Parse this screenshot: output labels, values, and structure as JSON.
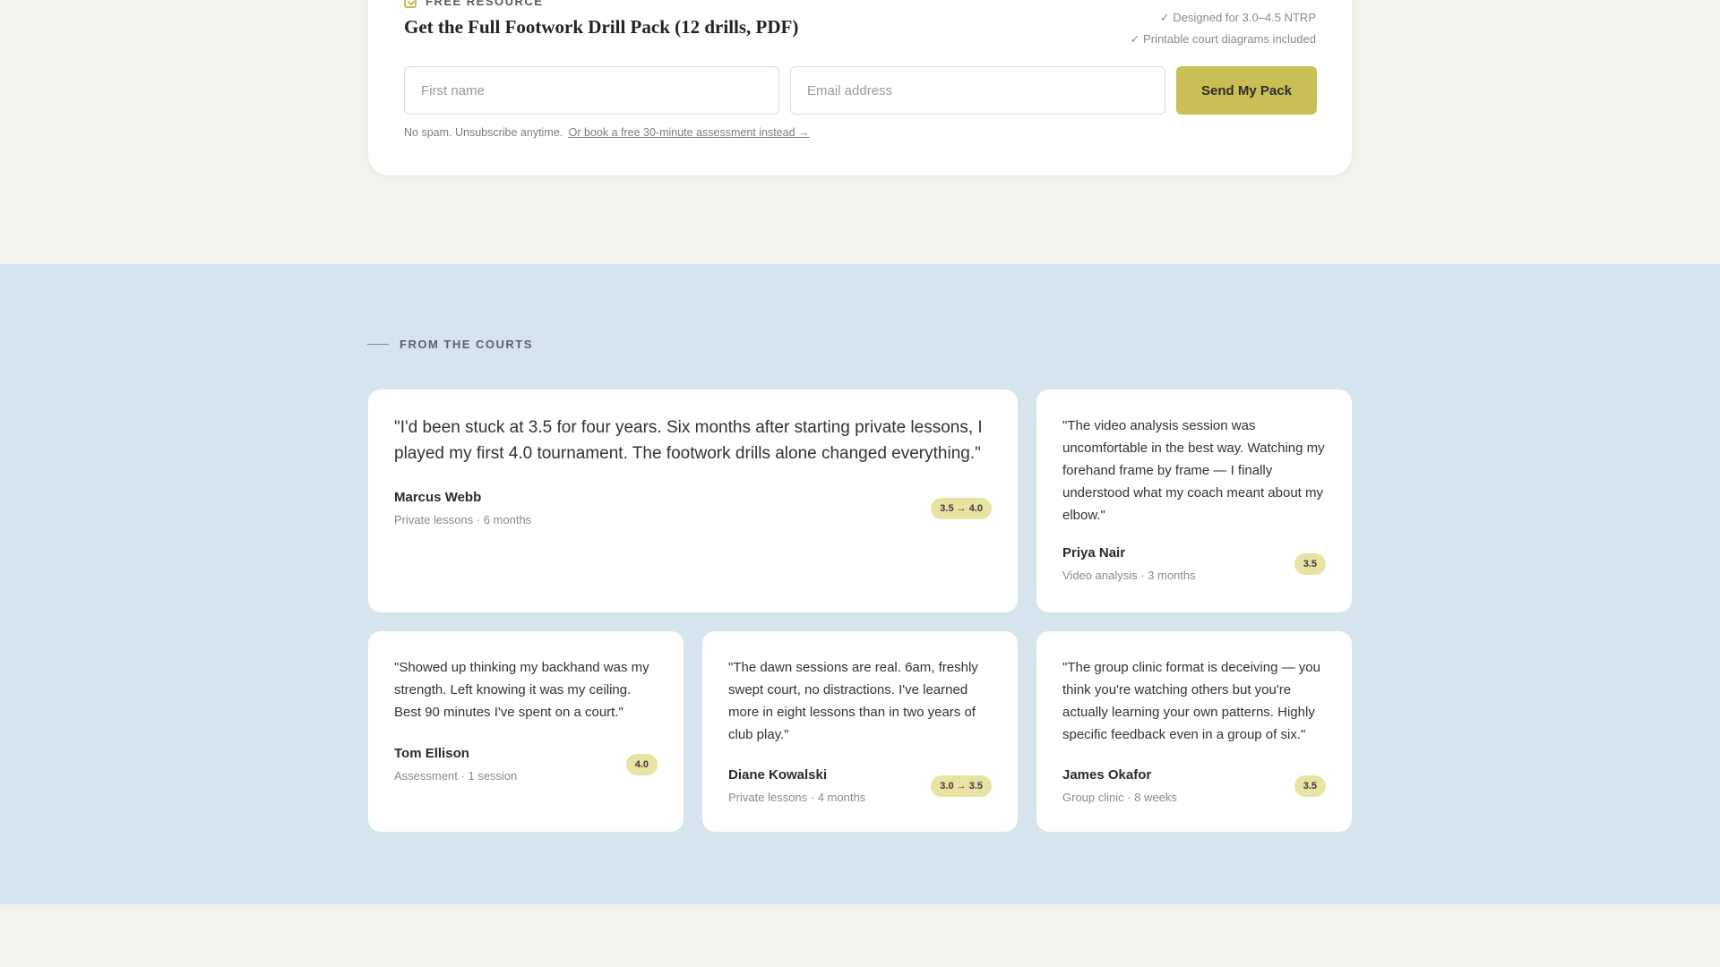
{
  "lead_magnet": {
    "eyebrow": "FREE RESOURCE",
    "title": "Get the Full Footwork Drill Pack (12 drills, PDF)",
    "perks": [
      "✓ Designed for 3.0–4.5 NTRP",
      "✓ Printable court diagrams included"
    ],
    "first_name_placeholder": "First name",
    "email_placeholder": "Email address",
    "submit_label": "Send My Pack",
    "fineprint": "No spam. Unsubscribe anytime.",
    "assessment_link": "Or book a free 30-minute assessment instead →"
  },
  "testimonials": {
    "section_label": "FROM THE COURTS",
    "items": [
      {
        "quote": "\"I'd been stuck at 3.5 for four years. Six months after starting private lessons, I played my first 4.0 tournament. The footwork drills alone changed everything.\"",
        "author": "Marcus Webb",
        "detail": "Private lessons · 6 months",
        "badge": "3.5 → 4.0"
      },
      {
        "quote": "\"The video analysis session was uncomfortable in the best way. Watching my forehand frame by frame — I finally understood what my coach meant about my elbow.\"",
        "author": "Priya Nair",
        "detail": "Video analysis · 3 months",
        "badge": "3.5"
      },
      {
        "quote": "\"Showed up thinking my backhand was my strength. Left knowing it was my ceiling. Best 90 minutes I've spent on a court.\"",
        "author": "Tom Ellison",
        "detail": "Assessment · 1 session",
        "badge": "4.0"
      },
      {
        "quote": "\"The dawn sessions are real. 6am, freshly swept court, no distractions. I've learned more in eight lessons than in two years of club play.\"",
        "author": "Diane Kowalski",
        "detail": "Private lessons · 4 months",
        "badge": "3.0 → 3.5"
      },
      {
        "quote": "\"The group clinic format is deceiving — you think you're watching others but you're actually learning your own patterns. Highly specific feedback even in a group of six.\"",
        "author": "James Okafor",
        "detail": "Group clinic · 8 weeks",
        "badge": "3.5"
      }
    ]
  },
  "colors": {
    "accent": "#c9bf55",
    "badge_bg": "#e8e3a3",
    "page_bg": "#f4f2ed",
    "testimonials_bg": "#d5e4ed"
  }
}
